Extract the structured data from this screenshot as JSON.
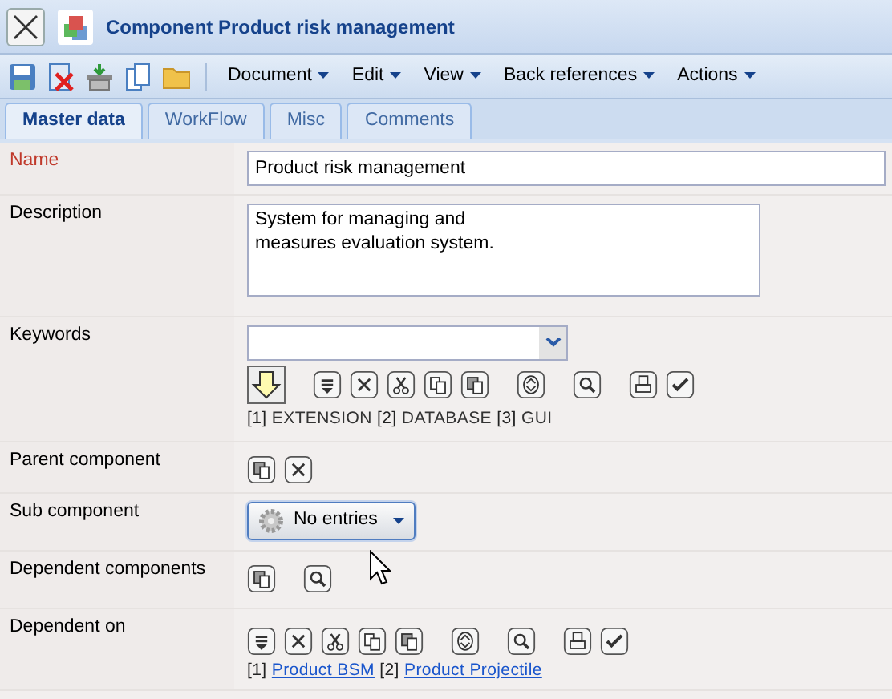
{
  "window": {
    "title": "Component Product risk management"
  },
  "menus": [
    {
      "label": "Document"
    },
    {
      "label": "Edit"
    },
    {
      "label": "View"
    },
    {
      "label": "Back references"
    },
    {
      "label": "Actions"
    }
  ],
  "tabs": [
    {
      "label": "Master data",
      "selected": true
    },
    {
      "label": "WorkFlow",
      "selected": false
    },
    {
      "label": "Misc",
      "selected": false
    },
    {
      "label": "Comments",
      "selected": false
    }
  ],
  "fields": [
    {
      "label": "Name",
      "required": true,
      "kind": "text",
      "value": "Product risk management"
    },
    {
      "label": "Description",
      "required": false,
      "kind": "textarea",
      "value": "System for managing and\nmeasures evaluation system."
    },
    {
      "label": "Keywords",
      "required": false,
      "kind": "keywords",
      "entries": [
        {
          "index": "[1]",
          "text": "EXTENSION"
        },
        {
          "index": "[2]",
          "text": "DATABASE"
        },
        {
          "index": "[3]",
          "text": "GUI"
        }
      ]
    },
    {
      "label": "Parent component",
      "required": false,
      "kind": "parent"
    },
    {
      "label": "Sub component",
      "required": false,
      "kind": "dropdown",
      "button": "No entries"
    },
    {
      "label": "Dependent components",
      "required": false,
      "kind": "dependents"
    },
    {
      "label": "Dependent on",
      "required": false,
      "kind": "links",
      "entries": [
        {
          "index": "[1]",
          "text": "Product BSM"
        },
        {
          "index": "[2]",
          "text": "Product Projectile"
        }
      ]
    }
  ]
}
